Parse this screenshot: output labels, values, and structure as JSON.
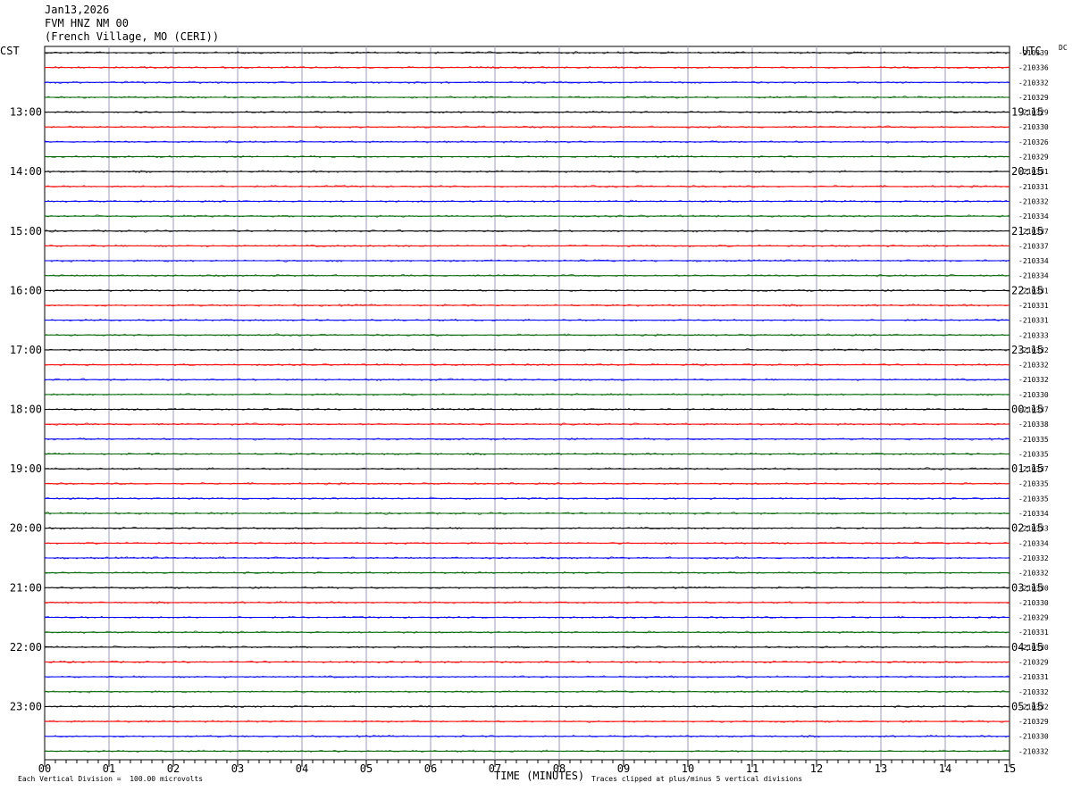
{
  "header": {
    "date": "Jan13,2026",
    "station": "FVM HNZ NM 00",
    "location": "(French Village, MO (CERI))"
  },
  "left_tz": "CST",
  "right_tz": "UTC",
  "dc_label": "DC",
  "footer": {
    "scale_note": "Each Vertical Division =  100.00 microvolts",
    "clip_note": "Traces clipped at plus/minus 5 vertical divisions",
    "x_title": "TIME (MINUTES)"
  },
  "colors": {
    "trace_cycle": [
      "#000000",
      "#ff0000",
      "#0000ff",
      "#006400"
    ],
    "grid": "#9999cc"
  },
  "chart_data": {
    "type": "line",
    "title": "",
    "xlabel": "TIME (MINUTES)",
    "ylabel": "",
    "xlim": [
      0,
      15
    ],
    "x_ticks": [
      "00",
      "01",
      "02",
      "03",
      "04",
      "05",
      "06",
      "07",
      "08",
      "09",
      "10",
      "11",
      "12",
      "13",
      "14",
      "15"
    ],
    "rows": 48,
    "rows_per_hour": 4,
    "left_hour_labels": [
      "13:00",
      "14:00",
      "15:00",
      "16:00",
      "17:00",
      "18:00",
      "19:00",
      "20:00",
      "21:00",
      "22:00",
      "23:00"
    ],
    "right_hour_labels": [
      "19:15",
      "20:15",
      "21:15",
      "22:15",
      "23:15",
      "00:15",
      "01:15",
      "02:15",
      "03:15",
      "04:15",
      "05:15"
    ],
    "dc_offsets": [
      "-210339",
      "-210336",
      "-210332",
      "-210329",
      "-210329",
      "-210330",
      "-210326",
      "-210329",
      "-210331",
      "-210331",
      "-210332",
      "-210334",
      "-210337",
      "-210337",
      "-210334",
      "-210334",
      "-210331",
      "-210331",
      "-210331",
      "-210333",
      "-210332",
      "-210332",
      "-210332",
      "-210330",
      "-210337",
      "-210338",
      "-210335",
      "-210335",
      "-210337",
      "-210335",
      "-210335",
      "-210334",
      "-210333",
      "-210334",
      "-210332",
      "-210332",
      "-210330",
      "-210330",
      "-210329",
      "-210331",
      "-210330",
      "-210329",
      "-210331",
      "-210332",
      "-210332",
      "-210329",
      "-210330",
      "-210332"
    ]
  }
}
